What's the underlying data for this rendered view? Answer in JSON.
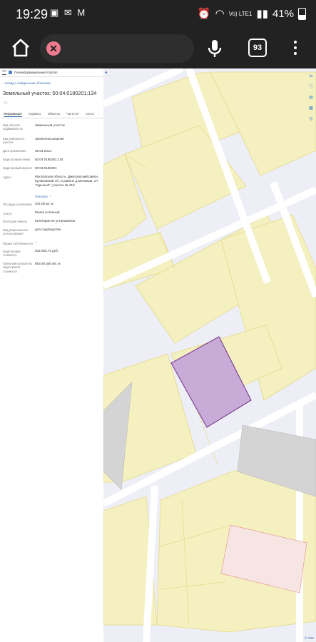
{
  "status": {
    "time": "19:29",
    "network": "Vo) LTE1",
    "battery": "41%"
  },
  "browser": {
    "tab_count": "93"
  },
  "panel": {
    "service": "Геоинформационный портал",
    "back_link": "Назад к найденным объектам",
    "title": "Земельный участок: 50:04:0180201:134",
    "tabs": [
      "Информация",
      "Сервисы",
      "Объекты",
      "Части ЗУ",
      "Соста"
    ],
    "rows": [
      {
        "label": "Вид объекта недвижимости",
        "value": "Земельный участок"
      },
      {
        "label": "Вид земельного участка",
        "value": "Землепользование"
      },
      {
        "label": "Дата присвоения",
        "value": "28.04.2013"
      },
      {
        "label": "Кадастровый номер",
        "value": "50:04:0180201:134"
      },
      {
        "label": "Кадастровый квартал",
        "value": "50:04:0180201"
      },
      {
        "label": "Адрес",
        "value": "Московская область, Дмитровский район, Куликовский с/с, в районе д.Мелкиши, с/т \"Удачный\", участок № 210"
      },
      {
        "label": "Площадь уточненная",
        "value": "404.00 кв. м"
      },
      {
        "label": "Статус",
        "value": "Ранее учтенный"
      },
      {
        "label": "Категория земель",
        "value": "Категория не установлена"
      },
      {
        "label": "Вид разрешенного использования",
        "value": "для садоводства"
      },
      {
        "label": "Форма собственности",
        "value": "–"
      },
      {
        "label": "Кадастровая стоимость",
        "value": "532 803,72 руб."
      },
      {
        "label": "Удельный показатель кадастровой стоимости",
        "value": "883.93 руб./кв. м"
      }
    ],
    "more_link": "Показать"
  },
  "map": {
    "copyright": "© ПКК",
    "colors": {
      "parcel": "#f5f0c0",
      "selected": "#c8abd6",
      "building": "#d4d4d4",
      "neighbour": "#f7e5e4"
    }
  }
}
